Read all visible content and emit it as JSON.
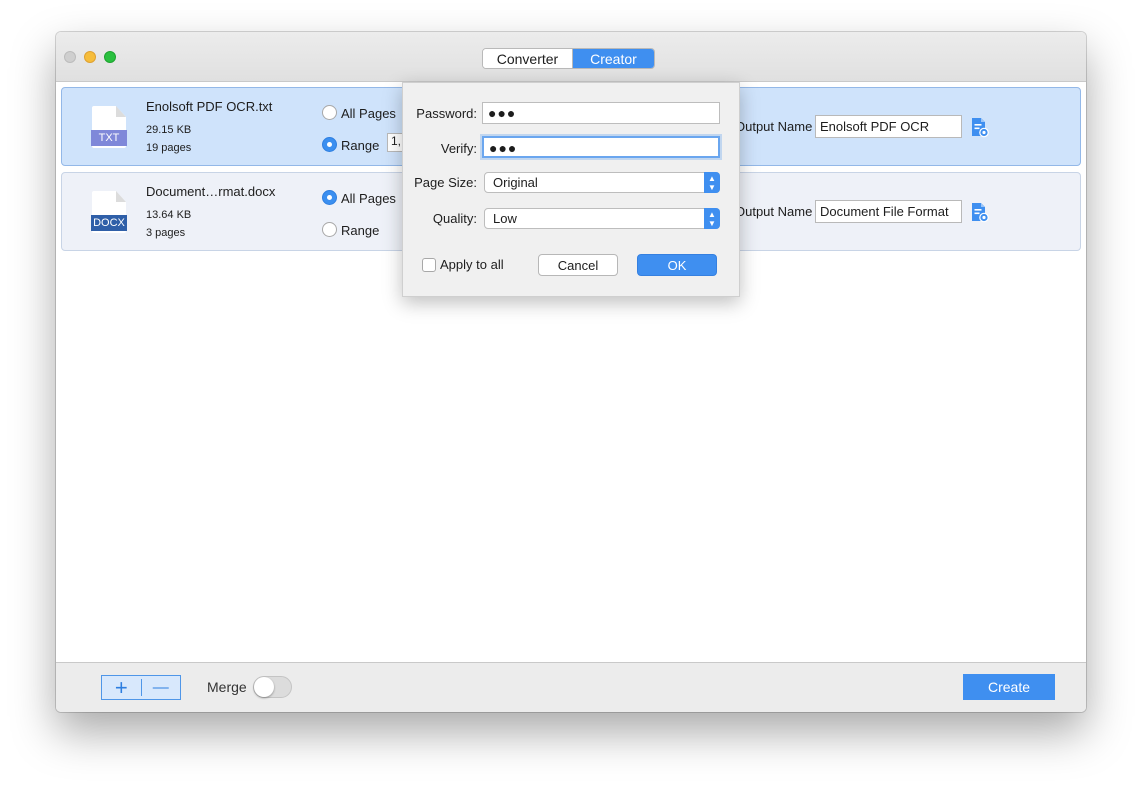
{
  "window": {
    "tabs": [
      {
        "label": "Converter",
        "selected": false
      },
      {
        "label": "Creator",
        "selected": true
      }
    ]
  },
  "files": [
    {
      "name": "Enolsoft PDF OCR.txt",
      "type_badge": "TXT",
      "size": "29.15 KB",
      "pages": "19 pages",
      "all_pages_label": "All Pages",
      "range_label": "Range",
      "page_mode": "Range",
      "range_value": "1,",
      "output_label": "Output Name",
      "output_name": "Enolsoft PDF OCR",
      "selected": true
    },
    {
      "name": "Document…rmat.docx",
      "type_badge": "DOCX",
      "size": "13.64 KB",
      "pages": "3 pages",
      "all_pages_label": "All Pages",
      "range_label": "Range",
      "page_mode": "All Pages",
      "output_label": "Output Name",
      "output_name": "Document File Format",
      "selected": false
    }
  ],
  "popover": {
    "password_label": "Password:",
    "password_value": "●●●",
    "verify_label": "Verify:",
    "verify_value": "●●●",
    "page_size_label": "Page Size:",
    "page_size_value": "Original",
    "quality_label": "Quality:",
    "quality_value": "Low",
    "apply_all_label": "Apply to all",
    "apply_all_checked": false,
    "cancel_label": "Cancel",
    "ok_label": "OK"
  },
  "bottom": {
    "add_symbol": "+",
    "remove_symbol": "—",
    "merge_label": "Merge",
    "merge_enabled": false,
    "create_label": "Create"
  },
  "colors": {
    "accent": "#3f8ff0",
    "selected_row": "#cfe3fb",
    "row": "#eef1f8",
    "txt_badge": "#7f88d9",
    "docx_badge": "#2f5fa8"
  },
  "icons": [
    "file-txt-icon",
    "file-docx-icon",
    "file-settings-icon",
    "stepper-arrows-icon"
  ]
}
